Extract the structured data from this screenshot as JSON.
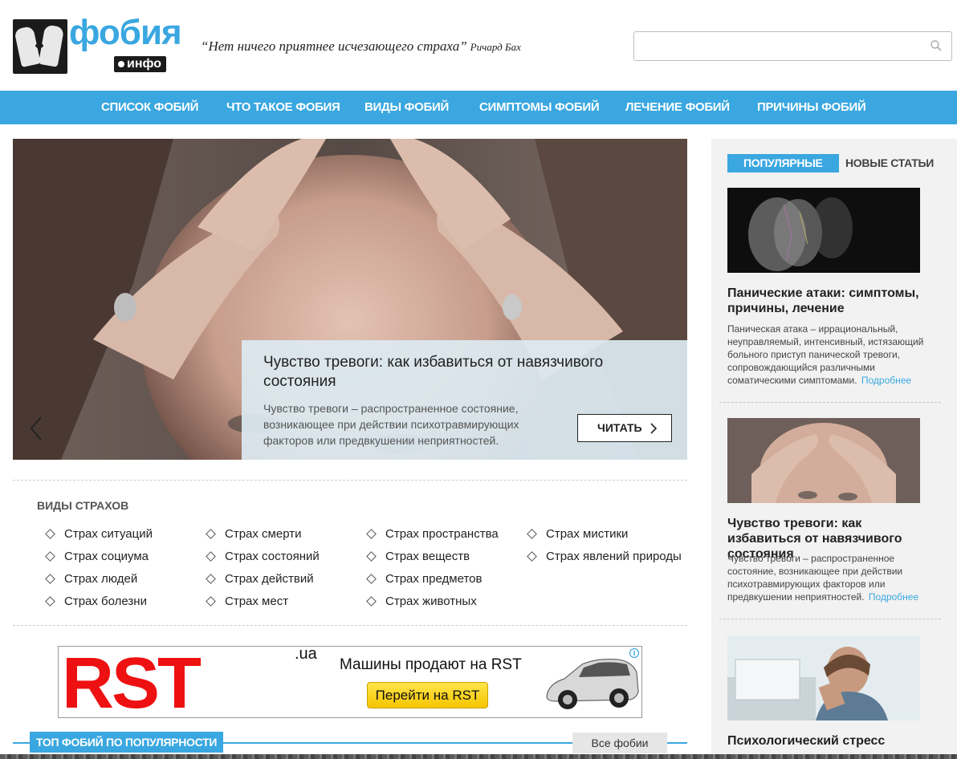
{
  "header": {
    "logo_word": "фобия",
    "logo_sub": "инфо",
    "quote": "“Нет ничего приятнее исчезающего страха”",
    "quote_author": "Ричард Бах",
    "search_placeholder": ""
  },
  "nav": {
    "items": [
      {
        "label": "Список фобий"
      },
      {
        "label": "Что такое фобия"
      },
      {
        "label": "Виды фобий"
      },
      {
        "label": "Симптомы фобий"
      },
      {
        "label": "Лечение фобий"
      },
      {
        "label": "Причины фобий"
      }
    ]
  },
  "slider": {
    "title": "Чувство тревоги: как избавиться от навязчивого состояния",
    "text": "Чувство тревоги – распространенное состояние, возникающее при действии психотравмирующих факторов или предвкушении неприятностей.",
    "read_label": "ЧИТАТЬ"
  },
  "fear_types": {
    "title": "Виды страхов",
    "columns": [
      [
        "Страх ситуаций",
        "Страх социума",
        "Страх людей",
        "Страх болезни"
      ],
      [
        "Страх смерти",
        "Страх состояний",
        "Страх действий",
        "Страх мест"
      ],
      [
        "Страх пространства",
        "Страх веществ",
        "Страх предметов",
        "Страх животных"
      ],
      [
        "Страх мистики",
        "Страх явлений природы"
      ]
    ]
  },
  "ad": {
    "logo": "RST",
    "domain": ".ua",
    "text": "Машины продают на RST",
    "button": "Перейти на RST",
    "info_mark": "i"
  },
  "top_phobias": {
    "label": "Топ фобий по популярности",
    "all_link": "Все фобии"
  },
  "sidebar": {
    "tabs": {
      "popular": "Популярные",
      "new": "Новые статьи"
    },
    "cards": [
      {
        "title": "Панические атаки: симптомы, причины, лечение",
        "text": "Паническая атака – иррациональный, неуправляемый, интенсивный, истязающий больного приступ панической тревоги, сопровождающийся различными соматическими симптомами.",
        "more": "Подробнее"
      },
      {
        "title": "Чувство тревоги: как избавиться от навязчивого состояния",
        "text": "Чувство тревоги – распространенное состояние, возникающее при действии психотравмирующих факторов или предвкушении неприятностей.",
        "more": "Подробнее"
      },
      {
        "title": "Психологический стресс",
        "text": "",
        "more": ""
      }
    ]
  },
  "colors": {
    "accent": "#3aa7e0",
    "ad_red": "#ee1111",
    "ad_button": "#f6c500"
  }
}
